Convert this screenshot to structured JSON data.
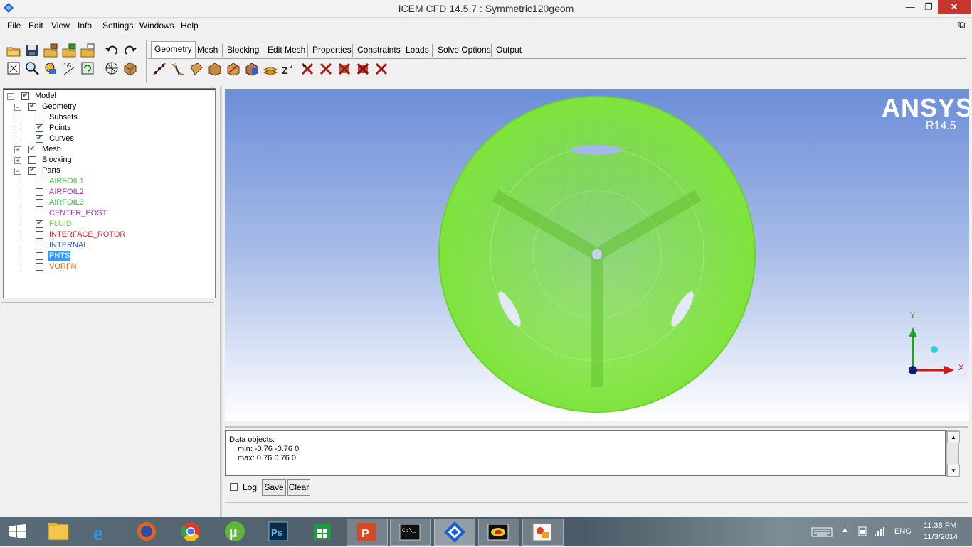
{
  "window": {
    "title": "ICEM CFD 14.5.7 : Symmetric120geom",
    "min_label": "—",
    "max_label": "❐",
    "close_label": "✕",
    "restore_label": "⧉"
  },
  "menu": [
    "File",
    "Edit",
    "View",
    "Info",
    "Settings",
    "Windows",
    "Help"
  ],
  "tabs": [
    "Geometry",
    "Mesh",
    "Blocking",
    "Edit Mesh",
    "Properties",
    "Constraints",
    "Loads",
    "Solve Options",
    "Output"
  ],
  "tree": {
    "items": [
      {
        "label": "Model",
        "color": "#000000",
        "checked": true
      },
      {
        "label": "Geometry",
        "color": "#000000",
        "checked": true
      },
      {
        "label": "Subsets",
        "color": "#000000",
        "checked": false
      },
      {
        "label": "Points",
        "color": "#000000",
        "checked": true
      },
      {
        "label": "Curves",
        "color": "#000000",
        "checked": true
      },
      {
        "label": "Mesh",
        "color": "#000000",
        "checked": true
      },
      {
        "label": "Blocking",
        "color": "#000000",
        "checked": false
      },
      {
        "label": "Parts",
        "color": "#000000",
        "checked": true
      },
      {
        "label": "AIRFOIL1",
        "color": "#3ccf3c",
        "checked": false
      },
      {
        "label": "AIRFOIL2",
        "color": "#9933cc",
        "checked": false
      },
      {
        "label": "AIRFOIL3",
        "color": "#33b33c",
        "checked": false
      },
      {
        "label": "CENTER_POST",
        "color": "#9933cc",
        "checked": false
      },
      {
        "label": "FLUID",
        "color": "#7cd63c",
        "checked": true
      },
      {
        "label": "INTERFACE_ROTOR",
        "color": "#d92b2b",
        "checked": false
      },
      {
        "label": "INTERNAL",
        "color": "#2b5fd9",
        "checked": false
      },
      {
        "label": "PNTS",
        "color": "#ffffff",
        "checked": false
      },
      {
        "label": "VORFN",
        "color": "#e0641c",
        "checked": false
      }
    ]
  },
  "viewport": {
    "brand": "ANSYS",
    "release": "R14.5",
    "mesh_color": "#7ee33c",
    "axis_y": "Y",
    "axis_x": "X"
  },
  "messages": {
    "line1": "Data objects:",
    "line2": "min: -0.76 -0.76 0",
    "line3": "max: 0.76 0.76 0"
  },
  "log_label": "Log",
  "save_label": "Save",
  "clear_label": "Clear",
  "taskbar": {
    "time": "11:38 PM",
    "date": "11/3/2014",
    "lang": "ENG"
  }
}
